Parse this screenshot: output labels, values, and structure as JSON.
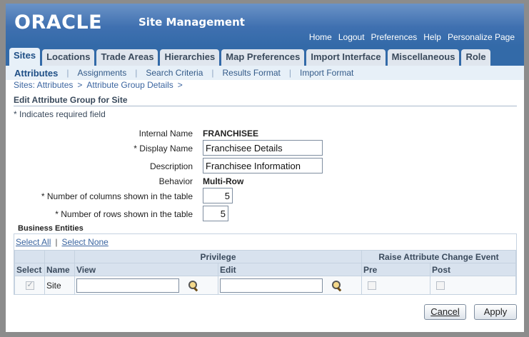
{
  "header": {
    "logo": "ORACLE",
    "app_title": "Site Management",
    "global_links": [
      "Home",
      "Logout",
      "Preferences",
      "Help",
      "Personalize Page"
    ]
  },
  "tabs": [
    {
      "label": "Sites",
      "active": true
    },
    {
      "label": "Locations"
    },
    {
      "label": "Trade Areas"
    },
    {
      "label": "Hierarchies"
    },
    {
      "label": "Map Preferences"
    },
    {
      "label": "Import Interface"
    },
    {
      "label": "Miscellaneous"
    },
    {
      "label": "Role"
    }
  ],
  "subtabs": [
    "Attributes",
    "Assignments",
    "Search Criteria",
    "Results Format",
    "Import Format"
  ],
  "breadcrumb": [
    "Sites: Attributes",
    ">",
    "Attribute Group Details",
    ">"
  ],
  "page": {
    "title": "Edit Attribute Group for Site",
    "required_note": "* Indicates required field"
  },
  "form": {
    "internal_name_label": "Internal Name",
    "internal_name_value": "FRANCHISEE",
    "display_name_label": "* Display Name",
    "display_name_value": "Franchisee Details",
    "description_label": "Description",
    "description_value": "Franchisee Information",
    "behavior_label": "Behavior",
    "behavior_value": "Multi-Row",
    "columns_label": "* Number of columns shown in the table",
    "columns_value": "5",
    "rows_label": "* Number of rows shown in the table",
    "rows_value": "5"
  },
  "business_entities": {
    "title": "Business Entities",
    "select_all": "Select All",
    "select_none": "Select None",
    "header_privilege": "Privilege",
    "header_raise": "Raise Attribute Change Event",
    "col_select": "Select",
    "col_name": "Name",
    "col_view": "View",
    "col_edit": "Edit",
    "col_pre": "Pre",
    "col_post": "Post",
    "rows": [
      {
        "name": "Site",
        "selected": true,
        "view": "",
        "edit": "",
        "pre": false,
        "post": false
      }
    ]
  },
  "buttons": {
    "cancel": "Cancel",
    "apply": "Apply"
  }
}
